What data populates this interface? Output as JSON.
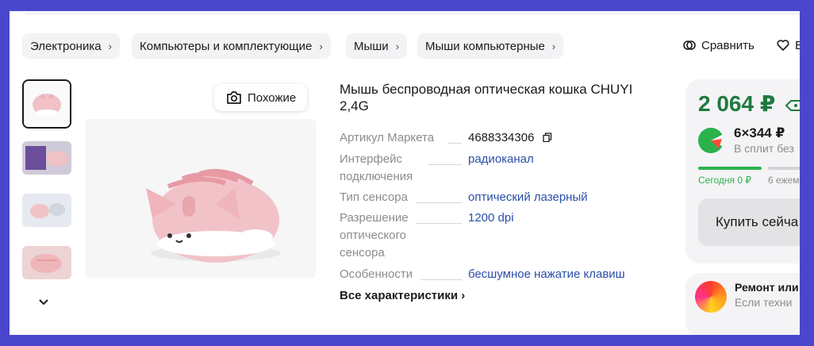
{
  "breadcrumbs": [
    {
      "label": "Электроника"
    },
    {
      "label": "Компьютеры и комплектующие"
    },
    {
      "label": "Мыши"
    },
    {
      "label": "Мыши компьютерные"
    }
  ],
  "breadcrumb_chevron": "›",
  "header_actions": {
    "compare_label": "Сравнить",
    "favorite_label": "В"
  },
  "gallery": {
    "similar_label": "Похожие",
    "more_chevron": "⌄"
  },
  "product": {
    "title": "Мышь беспроводная оптическая кошка CHUYI 2,4G",
    "specs": [
      {
        "label_lines": [
          "Артикул Маркета"
        ],
        "value": "4688334306"
      },
      {
        "label_lines": [
          "Интерфейс",
          "подключения"
        ],
        "value": "радиоканал"
      },
      {
        "label_lines": [
          "Тип сенсора"
        ],
        "value": "оптический лазерный"
      },
      {
        "label_lines": [
          "Разрешение",
          "оптического",
          "сенсора"
        ],
        "value": "1200 dpi"
      },
      {
        "label_lines": [
          "Особенности"
        ],
        "value": "бесшумное нажатие клавиш"
      }
    ],
    "all_specs_label": "Все характеристики ›"
  },
  "buy_box": {
    "price": "2 064 ₽",
    "split_amount": "6×344 ₽",
    "split_note": "В сплит без",
    "pay_today_label": "Сегодня 0 ₽",
    "pay_later_label": "6 ежем",
    "buy_label": "Купить сейча",
    "accent_color": "#1f7a3f"
  },
  "repair": {
    "title": "Ремонт или",
    "subtitle": "Если техни"
  }
}
